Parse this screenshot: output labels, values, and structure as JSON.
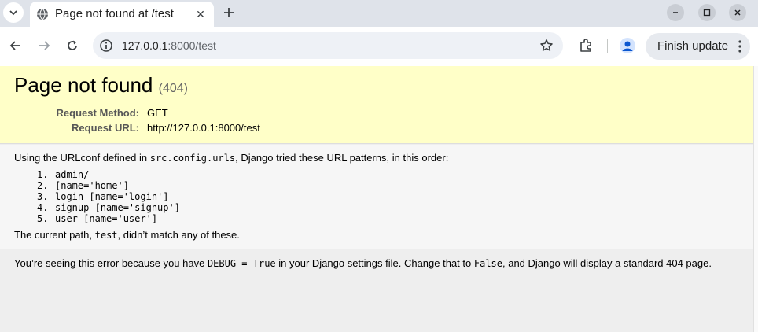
{
  "browser": {
    "tab": {
      "title": "Page not found at /test",
      "close_glyph": "✕"
    },
    "new_tab_glyph": "+",
    "window_controls": {
      "minimize_glyph": "–",
      "maximize_glyph": "□",
      "close_glyph": "✕"
    },
    "address": {
      "host": "127.0.0.1",
      "rest": ":8000/test"
    },
    "finish_update_label": "Finish update",
    "icons": [
      "chevron-down-icon",
      "globe-icon",
      "close-icon",
      "plus-icon",
      "back-arrow-icon",
      "forward-arrow-icon",
      "reload-icon",
      "info-icon",
      "star-icon",
      "extensions-icon",
      "profile-icon",
      "kebab-menu-icon"
    ]
  },
  "error_page": {
    "title": "Page not found",
    "status_code": "(404)",
    "request_method_label": "Request Method:",
    "request_method": "GET",
    "request_url_label": "Request URL:",
    "request_url": "http://127.0.0.1:8000/test",
    "urlconf_intro_before": "Using the URLconf defined in ",
    "urlconf_module": "src.config.urls",
    "urlconf_intro_after": ", Django tried these URL patterns, in this order:",
    "patterns": [
      {
        "num": "1.",
        "text": "admin/"
      },
      {
        "num": "2.",
        "text": "[name='home']"
      },
      {
        "num": "3.",
        "text": "login [name='login']"
      },
      {
        "num": "4.",
        "text": "signup [name='signup']"
      },
      {
        "num": "5.",
        "text": "user [name='user']"
      }
    ],
    "no_match_before": "The current path, ",
    "no_match_path": "test",
    "no_match_after": ", didn’t match any of these.",
    "debug_before": "You’re seeing this error because you have ",
    "debug_setting": "DEBUG = True",
    "debug_middle": " in your Django settings file. Change that to ",
    "debug_false": "False",
    "debug_after": ", and Django will display a standard 404 page."
  },
  "colors": {
    "summary_bg": "#ffffc8",
    "info_bg": "#f6f6f6",
    "explanation_bg": "#eeeeee",
    "tabstrip_bg": "#dfe3ea"
  }
}
